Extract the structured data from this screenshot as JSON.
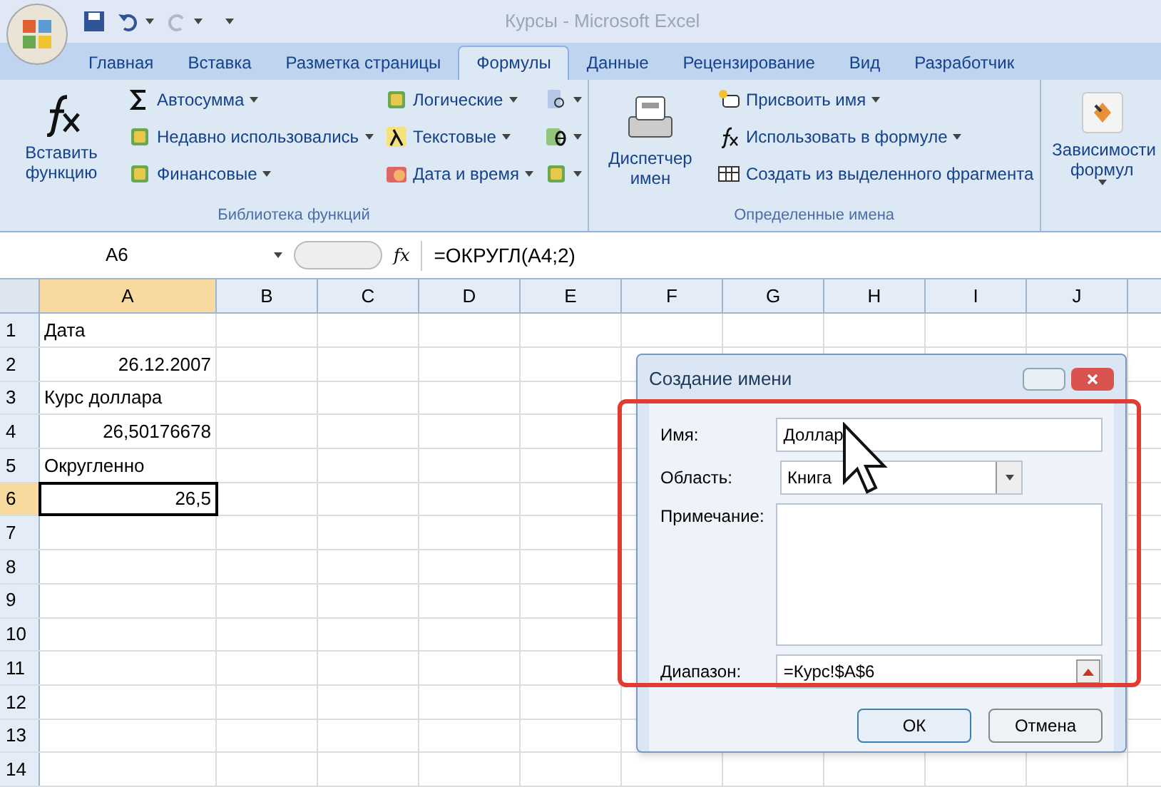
{
  "window": {
    "title": "Курсы - Microsoft Excel"
  },
  "tabs": [
    {
      "label": "Главная",
      "selected": false
    },
    {
      "label": "Вставка",
      "selected": false
    },
    {
      "label": "Разметка страницы",
      "selected": false
    },
    {
      "label": "Формулы",
      "selected": true
    },
    {
      "label": "Данные",
      "selected": false
    },
    {
      "label": "Рецензирование",
      "selected": false
    },
    {
      "label": "Вид",
      "selected": false
    },
    {
      "label": "Разработчик",
      "selected": false
    }
  ],
  "ribbon": {
    "groups": [
      {
        "label": "Библиотека функций",
        "large": {
          "label": "Вставить функцию",
          "kind": "fx",
          "dropdown": false
        },
        "columns": [
          [
            {
              "label": "Автосумма",
              "kind": "sigma",
              "dropdown": true
            },
            {
              "label": "Недавно использовались",
              "kind": "book",
              "dropdown": true
            },
            {
              "label": "Финансовые",
              "kind": "book",
              "dropdown": true
            }
          ],
          [
            {
              "label": "Логические",
              "kind": "book",
              "dropdown": true
            },
            {
              "label": "Текстовые",
              "kind": "lambda",
              "dropdown": true
            },
            {
              "label": "Дата и время",
              "kind": "clock",
              "dropdown": true
            }
          ],
          [
            {
              "kind": "search",
              "dropdown": true
            },
            {
              "kind": "theta",
              "dropdown": true
            },
            {
              "kind": "book",
              "dropdown": true
            }
          ]
        ]
      },
      {
        "label": "Определенные имена",
        "large": {
          "label": "Диспетчер имен",
          "kind": "cards",
          "dropdown": false
        },
        "columns": [
          [
            {
              "label": "Присвоить имя",
              "kind": "tag",
              "dropdown": true
            },
            {
              "label": "Использовать в формуле",
              "kind": "fx",
              "dropdown": true
            },
            {
              "label": "Создать из выделенного фрагмента",
              "kind": "grid",
              "dropdown": false
            }
          ]
        ]
      },
      {
        "large": {
          "label": "Зависимости формул",
          "kind": "audit",
          "dropdown": true
        }
      }
    ]
  },
  "formula_bar": {
    "name_box": "A6",
    "formula": "=ОКРУГЛ(A4;2)"
  },
  "sheet": {
    "columns": [
      {
        "label": "A",
        "selected": true
      },
      {
        "label": "B",
        "selected": false
      },
      {
        "label": "C",
        "selected": false
      },
      {
        "label": "D",
        "selected": false
      },
      {
        "label": "E",
        "selected": false
      },
      {
        "label": "F",
        "selected": false
      },
      {
        "label": "G",
        "selected": false
      },
      {
        "label": "H",
        "selected": false
      },
      {
        "label": "I",
        "selected": false
      },
      {
        "label": "J",
        "selected": false
      }
    ],
    "rows": [
      {
        "number": "1",
        "selected": false,
        "kind": "text",
        "value": "Дата"
      },
      {
        "number": "2",
        "selected": false,
        "kind": "number",
        "value": "26.12.2007"
      },
      {
        "number": "3",
        "selected": false,
        "kind": "text",
        "value": "Курс доллара"
      },
      {
        "number": "4",
        "selected": false,
        "kind": "number",
        "value": "26,50176678"
      },
      {
        "number": "5",
        "selected": false,
        "kind": "text",
        "value": "Округленно"
      },
      {
        "number": "6",
        "selected": true,
        "kind": "number",
        "value": "26,5"
      },
      {
        "number": "7",
        "selected": false
      },
      {
        "number": "8",
        "selected": false
      },
      {
        "number": "9",
        "selected": false
      },
      {
        "number": "10",
        "selected": false
      },
      {
        "number": "11",
        "selected": false
      },
      {
        "number": "12",
        "selected": false
      },
      {
        "number": "13",
        "selected": false
      },
      {
        "number": "14",
        "selected": false
      }
    ]
  },
  "dialog": {
    "title": "Создание имени",
    "name_label": "Имя:",
    "name_value": "Доллар",
    "scope_label": "Область:",
    "scope_value": "Книга",
    "comment_label": "Примечание:",
    "range_label": "Диапазон:",
    "range_value": "=Курс!$A$6",
    "buttons": [
      "ОК",
      "Отмена"
    ]
  }
}
